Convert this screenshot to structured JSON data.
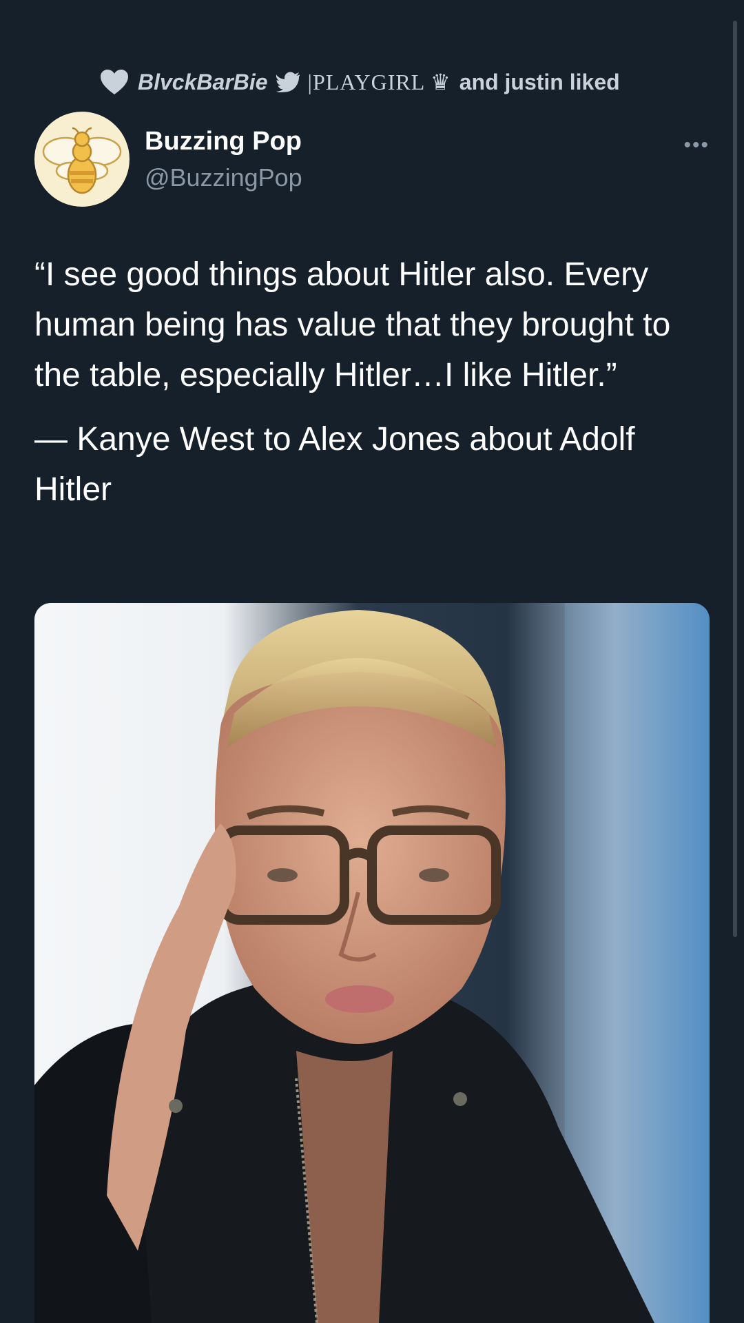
{
  "social_context": {
    "name": "BlvckBarBie",
    "rest": "|PLAYGIRL ♛",
    "suffix": "and justin liked"
  },
  "tweet": {
    "display_name": "Buzzing Pop",
    "handle": "@BuzzingPop",
    "more": "•••",
    "quote": "“I see good things about Hitler also. Every human being has value that they brought to the table, especially Hitler…I like Hitler.”",
    "attribution": "— Kanye West to Alex Jones about Adolf Hitler"
  },
  "icons": {
    "liked": "heart-icon",
    "bird": "twitter-bird-icon",
    "avatar": "bee-icon",
    "more": "more-options-icon"
  },
  "colors": {
    "background": "#15202b",
    "secondary_text": "#8b98a5",
    "primary_text": "#ffffff"
  }
}
